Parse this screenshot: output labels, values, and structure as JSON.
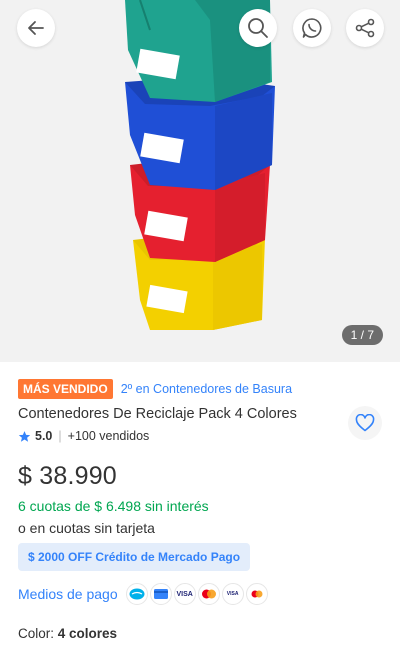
{
  "gallery": {
    "counter": "1 / 7",
    "bin_colors": [
      "#1fa38f",
      "#1f4fd6",
      "#e5202f",
      "#f3d000"
    ]
  },
  "icons": {
    "back": "arrow-left-icon",
    "search": "search-icon",
    "whatsapp": "whatsapp-icon",
    "share": "share-icon",
    "favorite": "heart-icon",
    "star": "star-icon"
  },
  "product": {
    "badge": "MÁS VENDIDO",
    "rank": "2º en Contenedores de Basura",
    "title": "Contenedores De Reciclaje Pack 4 Colores",
    "rating": "5.0",
    "sold": "+100 vendidos",
    "price": "$ 38.990",
    "installments": "6 cuotas de $ 6.498 sin interés",
    "installments_no_card": "o en cuotas sin tarjeta",
    "promo": "$ 2000 OFF Crédito de Mercado Pago",
    "payment_label": "Medios de pago",
    "payment_methods": [
      "mercado-pago",
      "credit",
      "VISA",
      "mastercard",
      "visa-debit",
      "mastercard-debit"
    ],
    "color_label": "Color:",
    "color_value": "4 colores"
  },
  "colors": {
    "accent": "#3483fa",
    "badge": "#ff7733",
    "success": "#00a650"
  }
}
